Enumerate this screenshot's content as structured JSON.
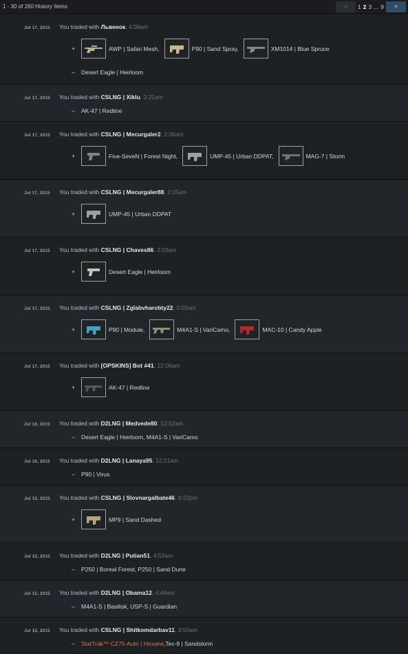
{
  "header": {
    "count": "1 - 30 of 260 History Items",
    "prev": "<",
    "next": ">",
    "pages": [
      "1",
      "2",
      "3",
      "...",
      "9"
    ],
    "current_page": "2"
  },
  "trade_prefix": "You traded with",
  "trades": [
    {
      "date": "Jul 17, 2015",
      "partner": "Львенок",
      "time": "4:08am",
      "received": [
        {
          "name": "AWP | Safari Mesh",
          "icon": "sniper-rifle-icon",
          "color": "#b8b28a"
        },
        {
          "name": "P90 | Sand Spray",
          "icon": "smg-icon",
          "color": "#c8b690"
        },
        {
          "name": "XM1014 | Blue Spruce",
          "icon": "shotgun-icon",
          "color": "#7c8a82"
        }
      ],
      "given_text": "Desert Eagle | Heirloom"
    },
    {
      "date": "Jul 17, 2015",
      "partner": "CSLNG | Xiklu",
      "time": "2:21am",
      "received": [],
      "given_text": "AK-47 | Redline"
    },
    {
      "date": "Jul 17, 2015",
      "partner": "CSLNG | Mecurgaler2",
      "time": "2:06am",
      "received": [
        {
          "name": "Five-SeveN | Forest Night",
          "icon": "pistol-icon",
          "color": "#7d8387"
        },
        {
          "name": "UMP-45 | Urban DDPAT",
          "icon": "smg-icon",
          "color": "#9aa0a5"
        },
        {
          "name": "MAG-7 | Storm",
          "icon": "shotgun-icon",
          "color": "#6b747a"
        }
      ],
      "given_text": ""
    },
    {
      "date": "Jul 17, 2015",
      "partner": "CSLNG | Mecurgaler88",
      "time": "2:05am",
      "received": [
        {
          "name": "UMP-45 | Urban DDPAT",
          "icon": "smg-icon",
          "color": "#9aa0a5"
        }
      ],
      "given_text": ""
    },
    {
      "date": "Jul 17, 2015",
      "partner": "CSLNG | Chaves86",
      "time": "2:03am",
      "received": [
        {
          "name": "Desert Eagle | Heirloom",
          "icon": "pistol-icon",
          "color": "#c9c3b4"
        }
      ],
      "given_text": ""
    },
    {
      "date": "Jul 17, 2015",
      "partner": "CSLNG | Zglabvharobty22",
      "time": "2:02am",
      "received": [
        {
          "name": "P90 | Module",
          "icon": "smg-icon",
          "color": "#3aa6c4"
        },
        {
          "name": "M4A1-S | VariCamo",
          "icon": "rifle-icon",
          "color": "#8c9276"
        },
        {
          "name": "MAC-10 | Candy Apple",
          "icon": "smg-icon",
          "color": "#b0282a"
        }
      ],
      "given_text": ""
    },
    {
      "date": "Jul 17, 2015",
      "partner": "[OPSKINS] Bot #41",
      "time": "12:06am",
      "received": [
        {
          "name": "AK-47 | Redline",
          "icon": "rifle-icon",
          "color": "#555a5e"
        }
      ],
      "given_text": ""
    },
    {
      "date": "Jul 16, 2015",
      "partner": "D2LNG | Medvede80",
      "time": "12:52am",
      "received": [],
      "given_text": "Desert Eagle | Heirloom, M4A1-S | VariCamo"
    },
    {
      "date": "Jul 16, 2015",
      "partner": "D2LNG | Lanaya95",
      "time": "12:21am",
      "received": [],
      "given_text": "P90 | Virus"
    },
    {
      "date": "Jul 15, 2015",
      "partner": "CSLNG | Slovnargalbate46",
      "time": "8:22pm",
      "received": [
        {
          "name": "MP9 | Sand Dashed",
          "icon": "smg-icon",
          "color": "#b5a47c"
        }
      ],
      "given_text": ""
    },
    {
      "date": "Jul 15, 2015",
      "partner": "D2LNG | Putian51",
      "time": "4:53am",
      "received": [],
      "given_text": "P250 | Boreal Forest, P250 | Sand Dune"
    },
    {
      "date": "Jul 15, 2015",
      "partner": "D2LNG | Obama12",
      "time": "4:46am",
      "received": [],
      "given_text": "M4A1-S | Basilisk, USP-S | Guardian"
    },
    {
      "date": "Jul 15, 2015",
      "partner": "CSLNG | Shitkomdarbav11",
      "time": "3:50am",
      "received": [],
      "given_text": "",
      "given_parts": [
        {
          "text": "StatTrak™ CZ75-Auto | Hexane",
          "stattrak": true
        },
        {
          "text": ", ",
          "stattrak": false
        },
        {
          "text": "Tec-9 | Sandstorm",
          "stattrak": false
        }
      ]
    }
  ]
}
